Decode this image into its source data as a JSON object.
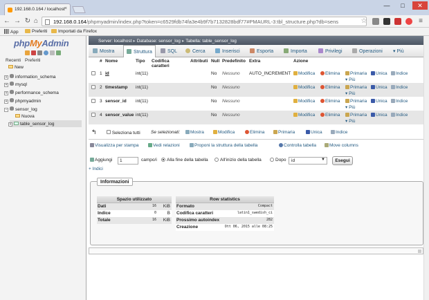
{
  "browser": {
    "tab_title": "192.168.0.164 / localhost",
    "url_domain": "192.168.0.164",
    "url_path": "/phpmyadmin/index.php?token=c6529fdb74fa3e4b9f7b7132828bdf77#PMAURL-3:tbl_structure.php?db=sens",
    "bookmarks": [
      "App",
      "Preferiti",
      "Importati da Firefox"
    ],
    "window_controls": [
      "—",
      "□",
      "✕"
    ]
  },
  "sidebar": {
    "logo_php": "php",
    "logo_my": "My",
    "logo_admin": "Admin",
    "tabs": [
      "Recenti",
      "Preferiti"
    ],
    "tree": [
      {
        "label": "New",
        "kind": "new"
      },
      {
        "label": "information_schema",
        "kind": "db"
      },
      {
        "label": "mysql",
        "kind": "db"
      },
      {
        "label": "performance_schema",
        "kind": "db"
      },
      {
        "label": "phpmyadmin",
        "kind": "db"
      },
      {
        "label": "sensor_log",
        "kind": "db"
      },
      {
        "label": "Nuova",
        "kind": "new-table"
      },
      {
        "label": "table_sensor_log",
        "kind": "table"
      }
    ]
  },
  "breadcrumb": {
    "server": "Server: localhost",
    "database": "Database: sensor_log",
    "table": "Tabella: table_sensor_log"
  },
  "menu": {
    "tabs": [
      "Mostra",
      "Struttura",
      "SQL",
      "Cerca",
      "Inserisci",
      "Esporta",
      "Importa",
      "Privilegi",
      "Operazioni",
      "Più"
    ],
    "active": "Struttura"
  },
  "structure": {
    "headers": {
      "num": "#",
      "name": "Nome",
      "type": "Tipo",
      "collation": "Codifica caratteri",
      "attributes": "Attributi",
      "null": "Null",
      "default": "Predefinito",
      "extra": "Extra",
      "action": "Azione"
    },
    "rows": [
      {
        "num": "1",
        "name": "id",
        "type": "int(11)",
        "collation": "",
        "attributes": "",
        "null": "No",
        "default": "Nessuno",
        "extra": "AUTO_INCREMENT"
      },
      {
        "num": "2",
        "name": "timestamp",
        "type": "int(11)",
        "collation": "",
        "attributes": "",
        "null": "No",
        "default": "Nessuno",
        "extra": ""
      },
      {
        "num": "3",
        "name": "sensor_id",
        "type": "int(11)",
        "collation": "",
        "attributes": "",
        "null": "No",
        "default": "Nessuno",
        "extra": ""
      },
      {
        "num": "4",
        "name": "sensor_value",
        "type": "int(11)",
        "collation": "",
        "attributes": "",
        "null": "No",
        "default": "Nessuno",
        "extra": ""
      }
    ],
    "row_actions": {
      "edit": "Modifica",
      "delete": "Elimina",
      "primary": "Primaria",
      "unique": "Unica",
      "index": "Indice",
      "more": "Più"
    }
  },
  "bulk": {
    "select_all": "Seleziona tutti",
    "selected_label": "Se selezionati:",
    "actions": [
      "Mostra",
      "Modifica",
      "Elimina",
      "Primaria",
      "Unica",
      "Indice"
    ]
  },
  "tools": [
    "Visualizza per stampa",
    "Vedi relazioni",
    "Proponi la struttura della tabella",
    "Controlla tabella",
    "Move columns"
  ],
  "add_fields": {
    "label": "Aggiungi",
    "count": "1",
    "fields_label": "campo/i",
    "at_end": "Alla fine della tabella",
    "at_start": "All'inizio della tabella",
    "after": "Dopo",
    "after_column": "id",
    "go": "Esegui"
  },
  "indexes_link": "+ Indici",
  "info": {
    "legend": "Informazioni",
    "space": {
      "title": "Spazio utilizzato",
      "rows": [
        {
          "label": "Dati",
          "value": "16",
          "unit": "KiB"
        },
        {
          "label": "Indice",
          "value": "0",
          "unit": "B"
        },
        {
          "label": "Totale",
          "value": "16",
          "unit": "KiB"
        }
      ]
    },
    "row_stats": {
      "title": "Row statistics",
      "rows": [
        {
          "label": "Formato",
          "value": "Compact"
        },
        {
          "label": "Codifica caratteri",
          "value": "latin1_swedish_ci"
        },
        {
          "label": "Prossimo autoindex",
          "value": "282"
        },
        {
          "label": "Creazione",
          "value": "Ott 06, 2015 alle 08:25"
        }
      ]
    }
  },
  "colors": {
    "breadcrumb_bg": "#5d6673",
    "link": "#235a81",
    "logo_blue": "#5a6ea6",
    "logo_orange": "#e27a1f"
  }
}
